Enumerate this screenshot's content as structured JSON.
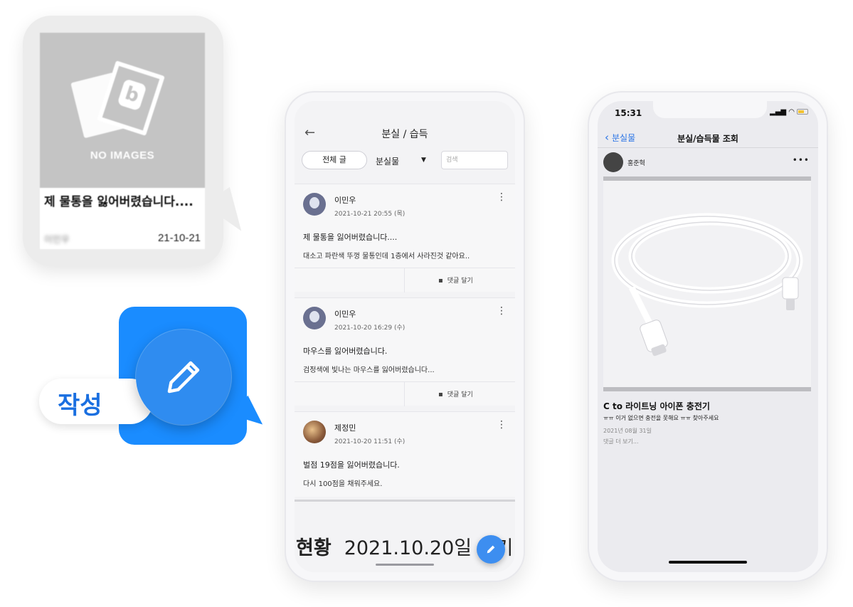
{
  "card": {
    "no_images_label": "NO IMAGES",
    "title": "제 물통을 잃어버렸습니다....",
    "author": "이민우",
    "date": "21-10-21"
  },
  "write_button": {
    "label": "작성"
  },
  "phone_list": {
    "title": "분실 / 습득",
    "filter_all": "전체 글",
    "category_select": "분실물",
    "search_placeholder": "검색",
    "posts": [
      {
        "author": "이민우",
        "datetime": "2021-10-21 20:55 (목)",
        "title": "제 물통을 잃어버렸습니다....",
        "body": "대소고 파란색 뚜껑 물통인데 1층에서 사라진것 같아요..",
        "comment_label": "댓글 달기"
      },
      {
        "author": "이민우",
        "datetime": "2021-10-20 16:29 (수)",
        "title": "마우스를 잃어버렸습니다.",
        "body": "검정색에 빛나는 마우스를 잃어버렸습니다...",
        "comment_label": "댓글 달기"
      },
      {
        "author": "제정민",
        "datetime": "2021-10-20 11:51 (수)",
        "title": "벌점 19점을 잃어버렸습니다.",
        "body": "다시 100점을 채워주세요."
      }
    ],
    "banner_bold": "현황",
    "banner_text": "2021.10.20일 기기"
  },
  "phone_detail": {
    "time": "15:31",
    "back_label": "분실물",
    "title": "분실/습득물 조회",
    "author": "홍준혁",
    "post_title": "C to 라이트닝 아이폰 충전기",
    "post_body": "ㅠㅠ 이거 없으면 충전을 못해요 ㅠㅠ 찾아주세요",
    "post_date": "2021년 08월 31일",
    "more_link": "댓글 더 보기..."
  }
}
